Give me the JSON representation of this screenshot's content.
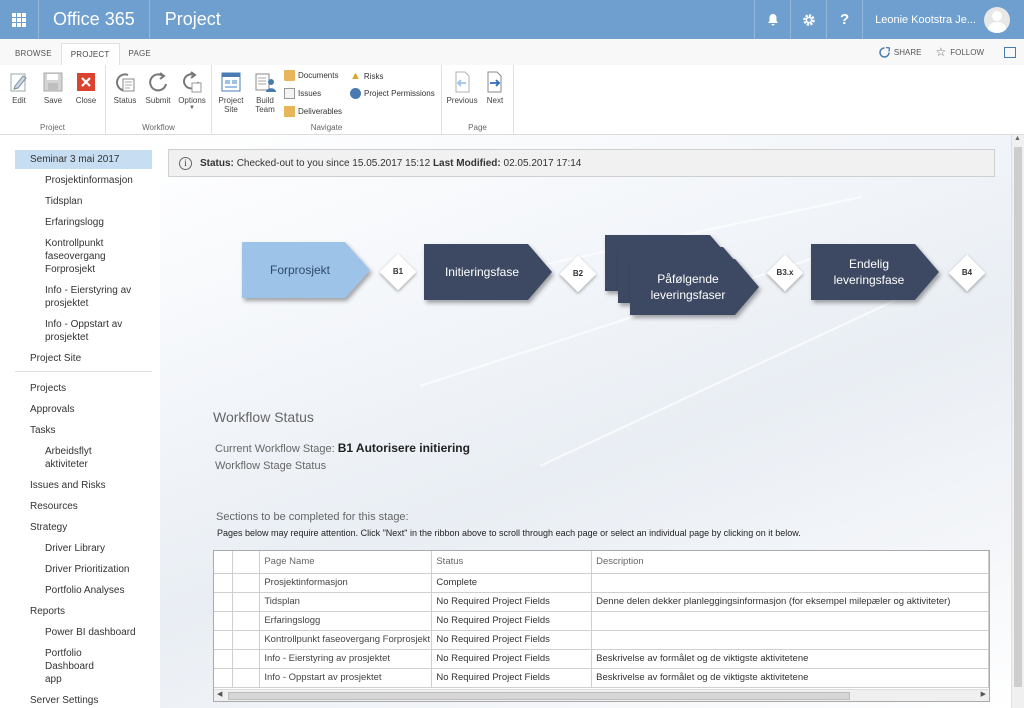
{
  "suite": {
    "brand": "Office 365",
    "app": "Project",
    "user": "Leonie Kootstra Je...",
    "icons": [
      "bell-icon",
      "gear-icon",
      "help-icon"
    ]
  },
  "tabs": {
    "items": [
      "BROWSE",
      "PROJECT",
      "PAGE"
    ],
    "active": "PROJECT",
    "share": "SHARE",
    "follow": "FOLLOW"
  },
  "ribbon": {
    "project_group": {
      "label": "Project",
      "edit": "Edit",
      "save": "Save",
      "close": "Close"
    },
    "workflow_group": {
      "label": "Workflow",
      "status": "Status",
      "submit": "Submit",
      "options": "Options"
    },
    "navigate_group": {
      "label": "Navigate",
      "project_site_1": "Project",
      "project_site_2": "Site",
      "build_team_1": "Build",
      "build_team_2": "Team",
      "documents": "Documents",
      "issues": "Issues",
      "deliverables": "Deliverables",
      "risks": "Risks",
      "project_permissions": "Project Permissions"
    },
    "page_group": {
      "label": "Page",
      "previous": "Previous",
      "next": "Next"
    }
  },
  "leftnav": {
    "selected": "Seminar 3 mai 2017",
    "sub_items": [
      "Prosjektinformasjon",
      "Tidsplan",
      "Erfaringslogg",
      "Kontrollpunkt faseovergang Forprosjekt",
      "Info - Eierstyring av prosjektet",
      "Info - Oppstart av prosjektet"
    ],
    "project_site": "Project Site",
    "items": {
      "projects": "Projects",
      "approvals": "Approvals",
      "tasks": "Tasks",
      "tasks_sub": "Arbeidsflyt aktiviteter",
      "issues_risks": "Issues and Risks",
      "resources": "Resources",
      "strategy": "Strategy",
      "strategy_sub": [
        "Driver Library",
        "Driver Prioritization",
        "Portfolio Analyses"
      ],
      "reports": "Reports",
      "reports_sub": [
        "Power BI dashboard",
        "Portfolio Dashboard app"
      ],
      "server_settings": "Server Settings"
    }
  },
  "status_bar": {
    "status_label": "Status:",
    "status_text": "Checked-out to you since 15.05.2017 15:12",
    "modified_label": "Last Modified:",
    "modified_text": "02.05.2017 17:14"
  },
  "workflow": {
    "stages": [
      "Forprosjekt",
      "Initieringsfase",
      "Påfølgende leveringsfaser",
      "Endelig leveringsfase"
    ],
    "gates": [
      "B1",
      "B2",
      "B3.x",
      "B4"
    ],
    "colors": {
      "active": "#9ec3e8",
      "inactive": "#3c4a63"
    }
  },
  "workflow_status": {
    "title": "Workflow Status",
    "current_label": "Current Workflow Stage:",
    "current_value": "B1 Autorisere initiering",
    "stage_status": "Workflow Stage Status",
    "sections_title": "Sections to be completed for this stage:",
    "sections_note": "Pages below may require attention. Click \"Next\" in the ribbon above to scroll through each page or select an individual page by clicking on it below."
  },
  "grid": {
    "headers": [
      "Page Name",
      "Status",
      "Description"
    ],
    "rows": [
      {
        "name": "Prosjektinformasjon",
        "status": "Complete",
        "desc": ""
      },
      {
        "name": "Tidsplan",
        "status": "No Required Project Fields",
        "desc": "Denne delen dekker planleggingsinformasjon (for eksempel milepæler og aktiviteter)"
      },
      {
        "name": "Erfaringslogg",
        "status": "No Required Project Fields",
        "desc": ""
      },
      {
        "name": "Kontrollpunkt faseovergang Forprosjekt",
        "status": "No Required Project Fields",
        "desc": ""
      },
      {
        "name": "Info - Eierstyring av prosjektet",
        "status": "No Required Project Fields",
        "desc": "Beskrivelse av formålet og de viktigste aktivitetene"
      },
      {
        "name": "Info - Oppstart av prosjektet",
        "status": "No Required Project Fields",
        "desc": "Beskrivelse av formålet og de viktigste aktivitetene"
      }
    ]
  }
}
